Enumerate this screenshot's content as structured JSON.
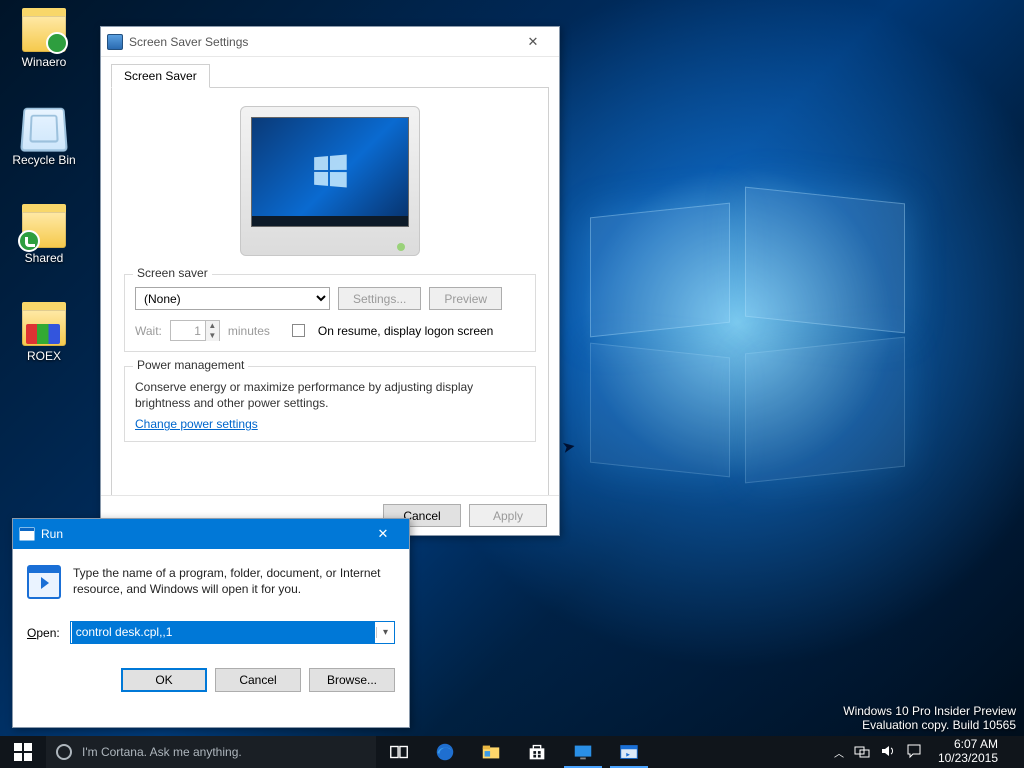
{
  "desktop_icons": {
    "winaero": "Winaero",
    "recycle_bin": "Recycle Bin",
    "shared": "Shared",
    "roex": "ROEX"
  },
  "screensaver_dialog": {
    "title": "Screen Saver Settings",
    "tab_label": "Screen Saver",
    "screensaver_group": {
      "legend": "Screen saver",
      "selected": "(None)",
      "settings_btn": "Settings...",
      "preview_btn": "Preview",
      "wait_label": "Wait:",
      "wait_value": "1",
      "minutes_label": "minutes",
      "resume_checkbox": "On resume, display logon screen"
    },
    "power_group": {
      "legend": "Power management",
      "text": "Conserve energy or maximize performance by adjusting display brightness and other power settings.",
      "link": "Change power settings"
    },
    "buttons": {
      "cancel": "Cancel",
      "apply": "Apply"
    }
  },
  "run_dialog": {
    "title": "Run",
    "message": "Type the name of a program, folder, document, or Internet resource, and Windows will open it for you.",
    "open_label": "Open:",
    "open_value": "control desk.cpl,,1",
    "ok": "OK",
    "cancel": "Cancel",
    "browse": "Browse..."
  },
  "watermark": {
    "line1": "Windows 10 Pro Insider Preview",
    "line2": "Evaluation copy. Build 10565"
  },
  "taskbar": {
    "search_placeholder": "I'm Cortana. Ask me anything.",
    "time": "6:07 AM",
    "date": "10/23/2015"
  }
}
